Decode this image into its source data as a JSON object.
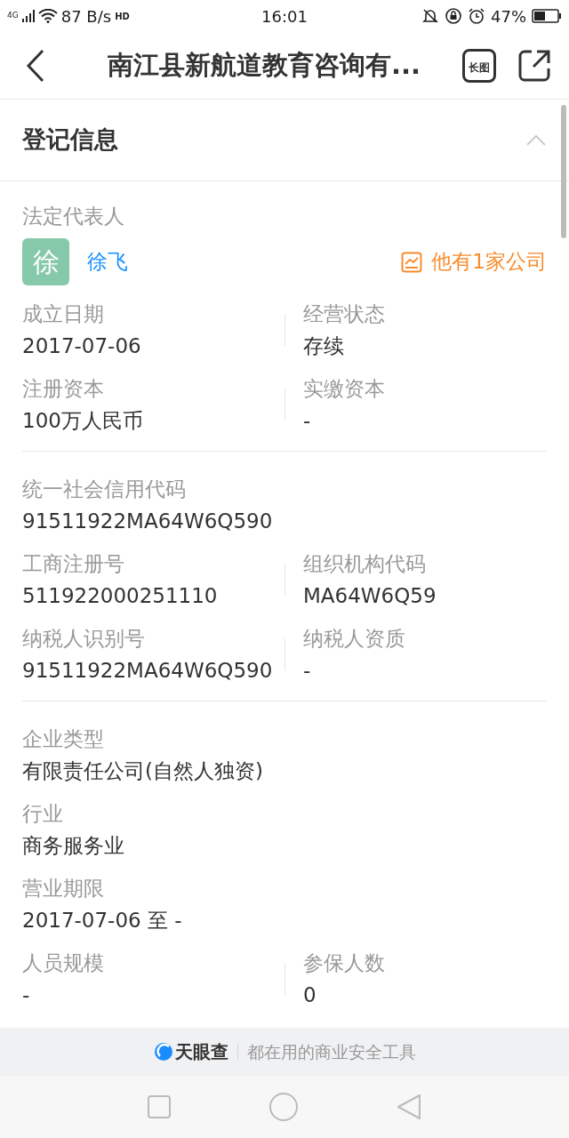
{
  "status_bar": {
    "network": "4G",
    "speed": "87 B/s",
    "hd": "HD",
    "time": "16:01",
    "battery": "47%"
  },
  "header": {
    "title": "南江县新航道教育咨询有...",
    "long_image_label": "长图"
  },
  "section": {
    "title": "登记信息",
    "expanded": true
  },
  "legal_rep": {
    "label": "法定代表人",
    "avatar": "徐",
    "name": "徐飞",
    "companies": "他有1家公司"
  },
  "groups": [
    {
      "rows": [
        [
          {
            "label": "成立日期",
            "value": "2017-07-06"
          },
          {
            "label": "经营状态",
            "value": "存续"
          }
        ],
        [
          {
            "label": "注册资本",
            "value": "100万人民币"
          },
          {
            "label": "实缴资本",
            "value": "-"
          }
        ]
      ]
    },
    {
      "rows": [
        [
          {
            "label": "统一社会信用代码",
            "value": "91511922MA64W6Q590"
          }
        ],
        [
          {
            "label": "工商注册号",
            "value": "511922000251110"
          },
          {
            "label": "组织机构代码",
            "value": "MA64W6Q59"
          }
        ],
        [
          {
            "label": "纳税人识别号",
            "value": "91511922MA64W6Q590"
          },
          {
            "label": "纳税人资质",
            "value": "-"
          }
        ]
      ]
    },
    {
      "rows": [
        [
          {
            "label": "企业类型",
            "value": "有限责任公司(自然人独资)"
          }
        ],
        [
          {
            "label": "行业",
            "value": "商务服务业"
          }
        ],
        [
          {
            "label": "营业期限",
            "value": "2017-07-06 至 -"
          }
        ],
        [
          {
            "label": "人员规模",
            "value": "-"
          },
          {
            "label": "参保人数",
            "value": "0"
          }
        ]
      ]
    }
  ],
  "footer": {
    "brand": "天眼查",
    "slogan": "都在用的商业安全工具"
  }
}
